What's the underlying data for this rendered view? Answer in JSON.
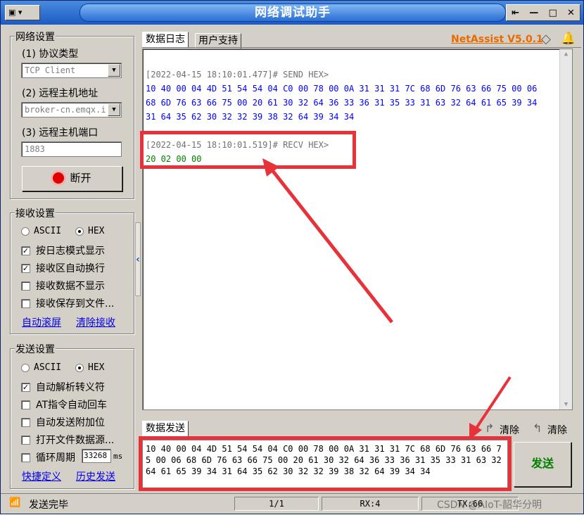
{
  "window": {
    "sys_menu": "▣ ▾",
    "title": "网络调试助手",
    "controls": [
      "⇤",
      "—",
      "□",
      "✕"
    ]
  },
  "net": {
    "group_label": "网络设置",
    "protocol_label": "(1) 协议类型",
    "protocol_value": "TCP Client",
    "host_label": "(2) 远程主机地址",
    "host_value": "broker-cn.emqx.i",
    "port_label": "(3) 远程主机端口",
    "port_value": "1883",
    "connect_button": "断开"
  },
  "recv": {
    "group_label": "接收设置",
    "mode_ascii": "ASCII",
    "mode_hex": "HEX",
    "selected_mode": "HEX",
    "options": [
      {
        "label": "按日志模式显示",
        "checked": true
      },
      {
        "label": "接收区自动换行",
        "checked": true
      },
      {
        "label": "接收数据不显示",
        "checked": false
      },
      {
        "label": "接收保存到文件...",
        "checked": false
      }
    ],
    "link_autoscroll": "自动滚屏",
    "link_clear": "清除接收"
  },
  "send": {
    "group_label": "发送设置",
    "mode_ascii": "ASCII",
    "mode_hex": "HEX",
    "selected_mode": "HEX",
    "options": [
      {
        "label": "自动解析转义符",
        "checked": true
      },
      {
        "label": "AT指令自动回车",
        "checked": false
      },
      {
        "label": "自动发送附加位",
        "checked": false
      },
      {
        "label": "打开文件数据源...",
        "checked": false
      }
    ],
    "loop_label": "循环周期",
    "loop_value": "33268",
    "loop_unit": "ms",
    "link_shortcut": "快捷定义",
    "link_history": "历史发送"
  },
  "tabs": {
    "log": "数据日志",
    "support": "用户支持",
    "brand": "NetAssist V5.0.1"
  },
  "log": {
    "send_header": "[2022-04-15 18:10:01.477]# SEND HEX>",
    "send_lines": [
      "10 40 00 04 4D 51 54 54 04 C0 00 78 00 0A 31 31 31 7C 68 6D 76 63 66 75 00 06",
      "68 6D 76 63 66 75 00 20 61 30 32 64 36 33 36 31 35 33 31 63 32 64 61 65 39 34",
      "31 64 35 62 30 32 32 39 38 32 64 39 34 34"
    ],
    "recv_header": "[2022-04-15 18:10:01.519]# RECV HEX>",
    "recv_line": "20 02 00 00"
  },
  "sendpanel": {
    "tab": "数据发送",
    "clear1": "清除",
    "clear2": "清除",
    "text": "10 40 00 04 4D 51 54 54 04 C0 00 78 00 0A 31 31 31 7C 68 6D 76 63 66 75 00 06 68 6D 76 63 66 75 00 20 61 30 32 64 36 33 36 31 35 33 31 63 32 64 61 65 39 34 31 64 35 62 30 32 32 39 38 32 64 39 34 34",
    "send_button": "发送"
  },
  "statusbar": {
    "text": "发送完毕",
    "page": "1/1",
    "rx": "RX:4",
    "tx": "TX:66",
    "watermark": "CSDN @AIoT-韶华分明"
  },
  "colors": {
    "accent_red": "#e8323a",
    "recv_green": "#008000",
    "send_blue": "#0000ff",
    "brand_orange": "#e86a00"
  }
}
